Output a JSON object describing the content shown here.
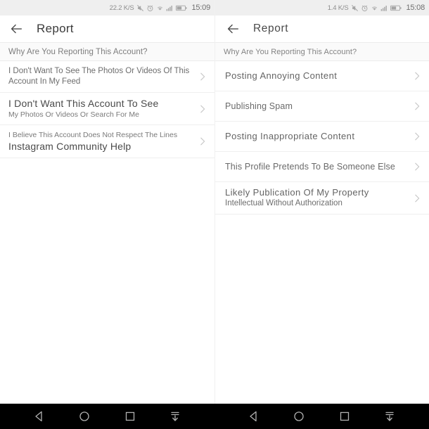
{
  "left": {
    "status_bar": {
      "network_speed": "22.2 K/S",
      "time": "15:09",
      "icons": [
        "mute-icon",
        "alarm-icon",
        "wifi-icon",
        "signal-icon",
        "battery-icon"
      ]
    },
    "appbar": {
      "back_icon": "back-arrow-icon",
      "title": "Report"
    },
    "section_header": "Why Are You Reporting This Account?",
    "items": [
      {
        "line_a": "I Don't Want To See The Photos Or Videos Of This",
        "line_b": "Account In My Feed",
        "chevron": "chevron-right-icon"
      },
      {
        "line_a": "I Don't Want This Account To See",
        "line_b": "My Photos Or Videos Or Search For Me",
        "chevron": "chevron-right-icon"
      },
      {
        "line_a": "I Believe This Account Does Not Respect The Lines",
        "line_b": "Instagram Community Help",
        "chevron": "chevron-right-icon"
      }
    ]
  },
  "right": {
    "status_bar": {
      "network_speed": "1.4 K/S",
      "time": "15:08",
      "icons": [
        "mute-icon",
        "alarm-icon",
        "wifi-icon",
        "signal-icon",
        "battery-icon"
      ]
    },
    "appbar": {
      "back_icon": "back-arrow-icon",
      "title": "Report"
    },
    "section_header": "Why Are You Reporting This Account?",
    "items": [
      {
        "line_a": "Posting Annoying Content",
        "line_b": "",
        "chevron": "chevron-right-icon"
      },
      {
        "line_a": "Publishing Spam",
        "line_b": "",
        "chevron": "chevron-right-icon"
      },
      {
        "line_a": "Posting Inappropriate Content",
        "line_b": "",
        "chevron": "chevron-right-icon"
      },
      {
        "line_a": "This Profile Pretends To Be Someone Else",
        "line_b": "",
        "chevron": "chevron-right-icon"
      },
      {
        "line_a": "Likely Publication Of My Property",
        "line_b": "Intellectual Without Authorization",
        "chevron": "chevron-right-icon"
      }
    ]
  },
  "navbar": {
    "buttons": [
      "back-triangle-icon",
      "home-circle-icon",
      "recents-square-icon",
      "hide-navbar-icon"
    ]
  },
  "colors": {
    "status_bar_bg": "#efefef",
    "page_bg": "#ffffff",
    "section_bg": "#fafafa",
    "divider": "#efefef",
    "text_primary": "#4a4a4a",
    "text_secondary": "#6d6d6d",
    "navbar_bg": "#000000"
  }
}
